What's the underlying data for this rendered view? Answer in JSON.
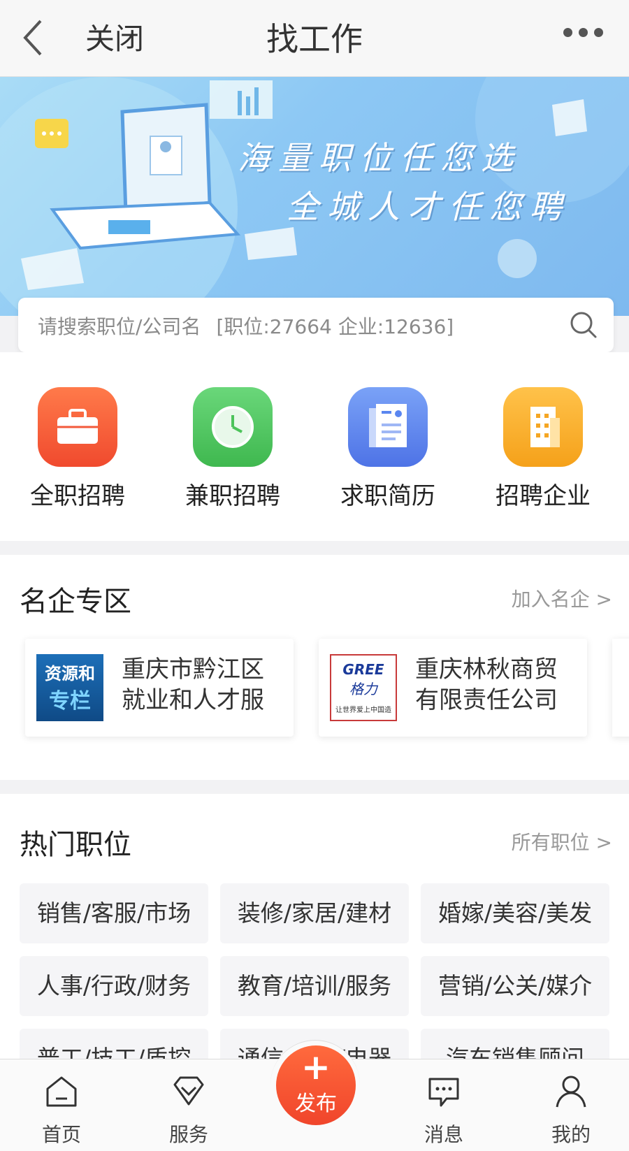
{
  "header": {
    "close_label": "关闭",
    "title": "找工作"
  },
  "banner": {
    "line1": "海量职位任您选",
    "line2": "全城人才任您聘"
  },
  "search": {
    "placeholder": "请搜索职位/公司名",
    "stats": "[职位:27664  企业:12636]"
  },
  "quick_entries": [
    {
      "label": "全职招聘",
      "icon": "briefcase-icon",
      "color": "#f35a3a"
    },
    {
      "label": "兼职招聘",
      "icon": "clock-icon",
      "color": "#4cc35a"
    },
    {
      "label": "求职简历",
      "icon": "resume-icon",
      "color": "#5a86f0"
    },
    {
      "label": "招聘企业",
      "icon": "building-icon",
      "color": "#f5a623"
    }
  ],
  "famous_companies": {
    "title": "名企专区",
    "more": "加入名企 >",
    "items": [
      {
        "name": "重庆市黔江区就业和人才服",
        "logo_text": "资源和专栏"
      },
      {
        "name": "重庆林秋商贸有限责任公司",
        "logo_text": "GREE 格力"
      }
    ]
  },
  "hot_jobs": {
    "title": "热门职位",
    "more": "所有职位 >",
    "items": [
      "销售/客服/市场",
      "装修/家居/建材",
      "婚嫁/美容/美发",
      "人事/行政/财务",
      "教育/培训/服务",
      "营销/公关/媒介",
      "普工/技工/质控",
      "通信/电子/电器",
      "汽车销售顾问"
    ]
  },
  "tabbar": {
    "home": "首页",
    "service": "服务",
    "publish": "发布",
    "message": "消息",
    "mine": "我的"
  },
  "colors": {
    "accent": "#f0452b",
    "banner": "#8dc8f4"
  }
}
